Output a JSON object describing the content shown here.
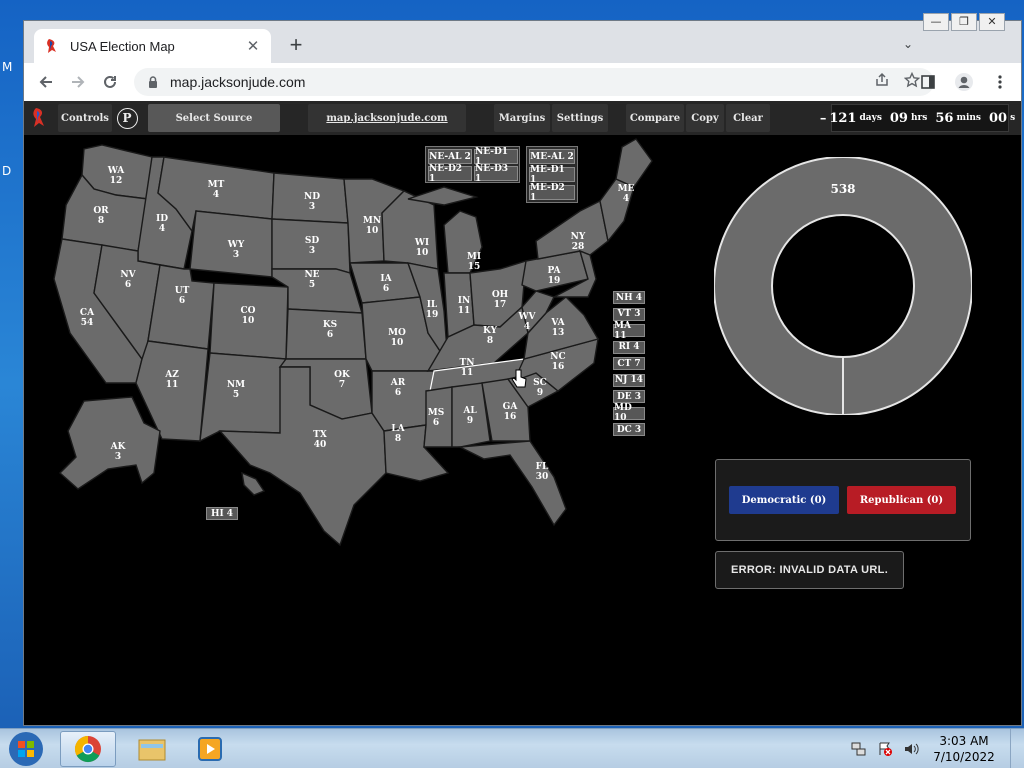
{
  "desktop": {
    "frag1": "M",
    "frag2": "D"
  },
  "window_controls": {
    "minimize": "—",
    "restore": "❐",
    "close": "✕"
  },
  "tab": {
    "title": "USA Election Map",
    "close": "✕"
  },
  "new_tab_label": "+",
  "tab_menu": "⌄",
  "address_bar": {
    "url": "map.jacksonjude.com"
  },
  "topnav": {
    "controls": "Controls",
    "p": "P",
    "select_source": "Select Source",
    "site": "map.jacksonjude.com",
    "margins": "Margins",
    "settings": "Settings",
    "compare": "Compare",
    "copy": "Copy",
    "clear": "Clear",
    "countdown": {
      "sign": "–",
      "days": "121",
      "days_u": "days",
      "hrs": "09",
      "hrs_u": "hrs",
      "mins": "56",
      "mins_u": "mins",
      "secs": "00",
      "secs_u": "s"
    }
  },
  "states": [
    {
      "abbr": "WA",
      "ev": "12"
    },
    {
      "abbr": "OR",
      "ev": "8"
    },
    {
      "abbr": "CA",
      "ev": "54"
    },
    {
      "abbr": "ID",
      "ev": "4"
    },
    {
      "abbr": "NV",
      "ev": "6"
    },
    {
      "abbr": "MT",
      "ev": "4"
    },
    {
      "abbr": "WY",
      "ev": "3"
    },
    {
      "abbr": "UT",
      "ev": "6"
    },
    {
      "abbr": "AZ",
      "ev": "11"
    },
    {
      "abbr": "CO",
      "ev": "10"
    },
    {
      "abbr": "NM",
      "ev": "5"
    },
    {
      "abbr": "ND",
      "ev": "3"
    },
    {
      "abbr": "SD",
      "ev": "3"
    },
    {
      "abbr": "NE",
      "ev": "5"
    },
    {
      "abbr": "KS",
      "ev": "6"
    },
    {
      "abbr": "OK",
      "ev": "7"
    },
    {
      "abbr": "TX",
      "ev": "40"
    },
    {
      "abbr": "MN",
      "ev": "10"
    },
    {
      "abbr": "IA",
      "ev": "6"
    },
    {
      "abbr": "MO",
      "ev": "10"
    },
    {
      "abbr": "AR",
      "ev": "6"
    },
    {
      "abbr": "LA",
      "ev": "8"
    },
    {
      "abbr": "WI",
      "ev": "10"
    },
    {
      "abbr": "IL",
      "ev": "19"
    },
    {
      "abbr": "MI",
      "ev": "15"
    },
    {
      "abbr": "IN",
      "ev": "11"
    },
    {
      "abbr": "OH",
      "ev": "17"
    },
    {
      "abbr": "KY",
      "ev": "8"
    },
    {
      "abbr": "TN",
      "ev": "11"
    },
    {
      "abbr": "MS",
      "ev": "6"
    },
    {
      "abbr": "AL",
      "ev": "9"
    },
    {
      "abbr": "GA",
      "ev": "16"
    },
    {
      "abbr": "FL",
      "ev": "30"
    },
    {
      "abbr": "SC",
      "ev": "9"
    },
    {
      "abbr": "NC",
      "ev": "16"
    },
    {
      "abbr": "VA",
      "ev": "13"
    },
    {
      "abbr": "WV",
      "ev": "4"
    },
    {
      "abbr": "PA",
      "ev": "19"
    },
    {
      "abbr": "NY",
      "ev": "28"
    },
    {
      "abbr": "ME",
      "ev": "4"
    },
    {
      "abbr": "AK",
      "ev": "3"
    }
  ],
  "small_states": [
    {
      "label": "NH 4"
    },
    {
      "label": "VT 3"
    },
    {
      "label": "MA 11"
    },
    {
      "label": "RI 4"
    },
    {
      "label": "CT 7"
    },
    {
      "label": "NJ 14"
    },
    {
      "label": "DE 3"
    },
    {
      "label": "MD 10"
    },
    {
      "label": "DC 3"
    }
  ],
  "hi": "HI 4",
  "districts": {
    "ne_al": "NE-AL 2",
    "ne_d1": "NE-D1 1",
    "ne_d2": "NE-D2 1",
    "ne_d3": "NE-D3 1",
    "me_al": "ME-AL 2",
    "me_d1": "ME-D1 1",
    "me_d2": "ME-D2 1"
  },
  "donut": {
    "total": "538"
  },
  "parties": {
    "dem": {
      "label": "Democratic (0)",
      "color": "#1f3b8f"
    },
    "rep": {
      "label": "Republican (0)",
      "color": "#b81c25"
    }
  },
  "error": "ERROR: INVALID DATA URL.",
  "taskbar": {
    "time": "3:03 AM",
    "date": "7/10/2022"
  }
}
